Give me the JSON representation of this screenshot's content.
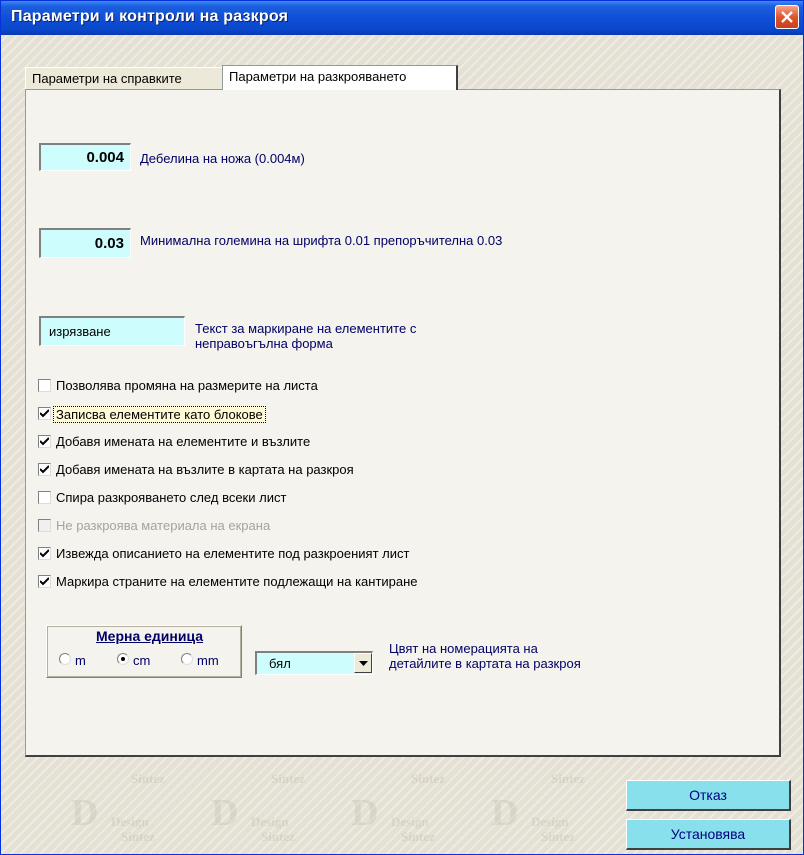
{
  "window": {
    "title": "Параметри и контроли на разкроя"
  },
  "tabs": [
    {
      "label": "Параметри на справките",
      "active": false
    },
    {
      "label": "Параметри на разкрояването",
      "active": true
    }
  ],
  "knife": {
    "value": "0.004",
    "label": "Дебелина на ножа (0.004м)"
  },
  "font": {
    "value": "0.03",
    "label": "Минимална големина на шрифта  0.01  препоръчителна 0.03"
  },
  "mark_text": {
    "value": "изрязване",
    "label": "Текст за маркиране на елементите с неправоъгълна форма"
  },
  "checkboxes": [
    {
      "label": "Позволява промяна на размерите на листа",
      "checked": false,
      "enabled": true
    },
    {
      "label": "Записва елементите като блокове",
      "checked": true,
      "enabled": true
    },
    {
      "label": "Добавя имената на елементите и възлите",
      "checked": true,
      "enabled": true
    },
    {
      "label": "Добавя имената на възлите в картата на разкроя",
      "checked": true,
      "enabled": true
    },
    {
      "label": "Спира разкрояването след всеки лист",
      "checked": false,
      "enabled": true
    },
    {
      "label": "Не разкроява материала на екрана",
      "checked": false,
      "enabled": false
    },
    {
      "label": "Извежда описанието на елементите под разкроеният лист",
      "checked": true,
      "enabled": true
    },
    {
      "label": "Маркира страните на елементите подлежащи на кантиране",
      "checked": true,
      "enabled": true
    }
  ],
  "units": {
    "title": "Мерна единица",
    "options": [
      "m",
      "cm",
      "mm"
    ],
    "selected": "cm"
  },
  "color": {
    "value": "бял",
    "label": "Цвят на номерацията на детайлите в картата на разкроя"
  },
  "buttons": {
    "cancel": "Отказ",
    "apply": "Установява"
  },
  "watermark": {
    "letter": "D",
    "word1": "Design",
    "word2": "Sintez"
  },
  "colors": {
    "field_bg": "#cdfdfd",
    "button_bg": "#88e0ec",
    "label_text": "#000066",
    "titlebar": "#0a47cc"
  }
}
